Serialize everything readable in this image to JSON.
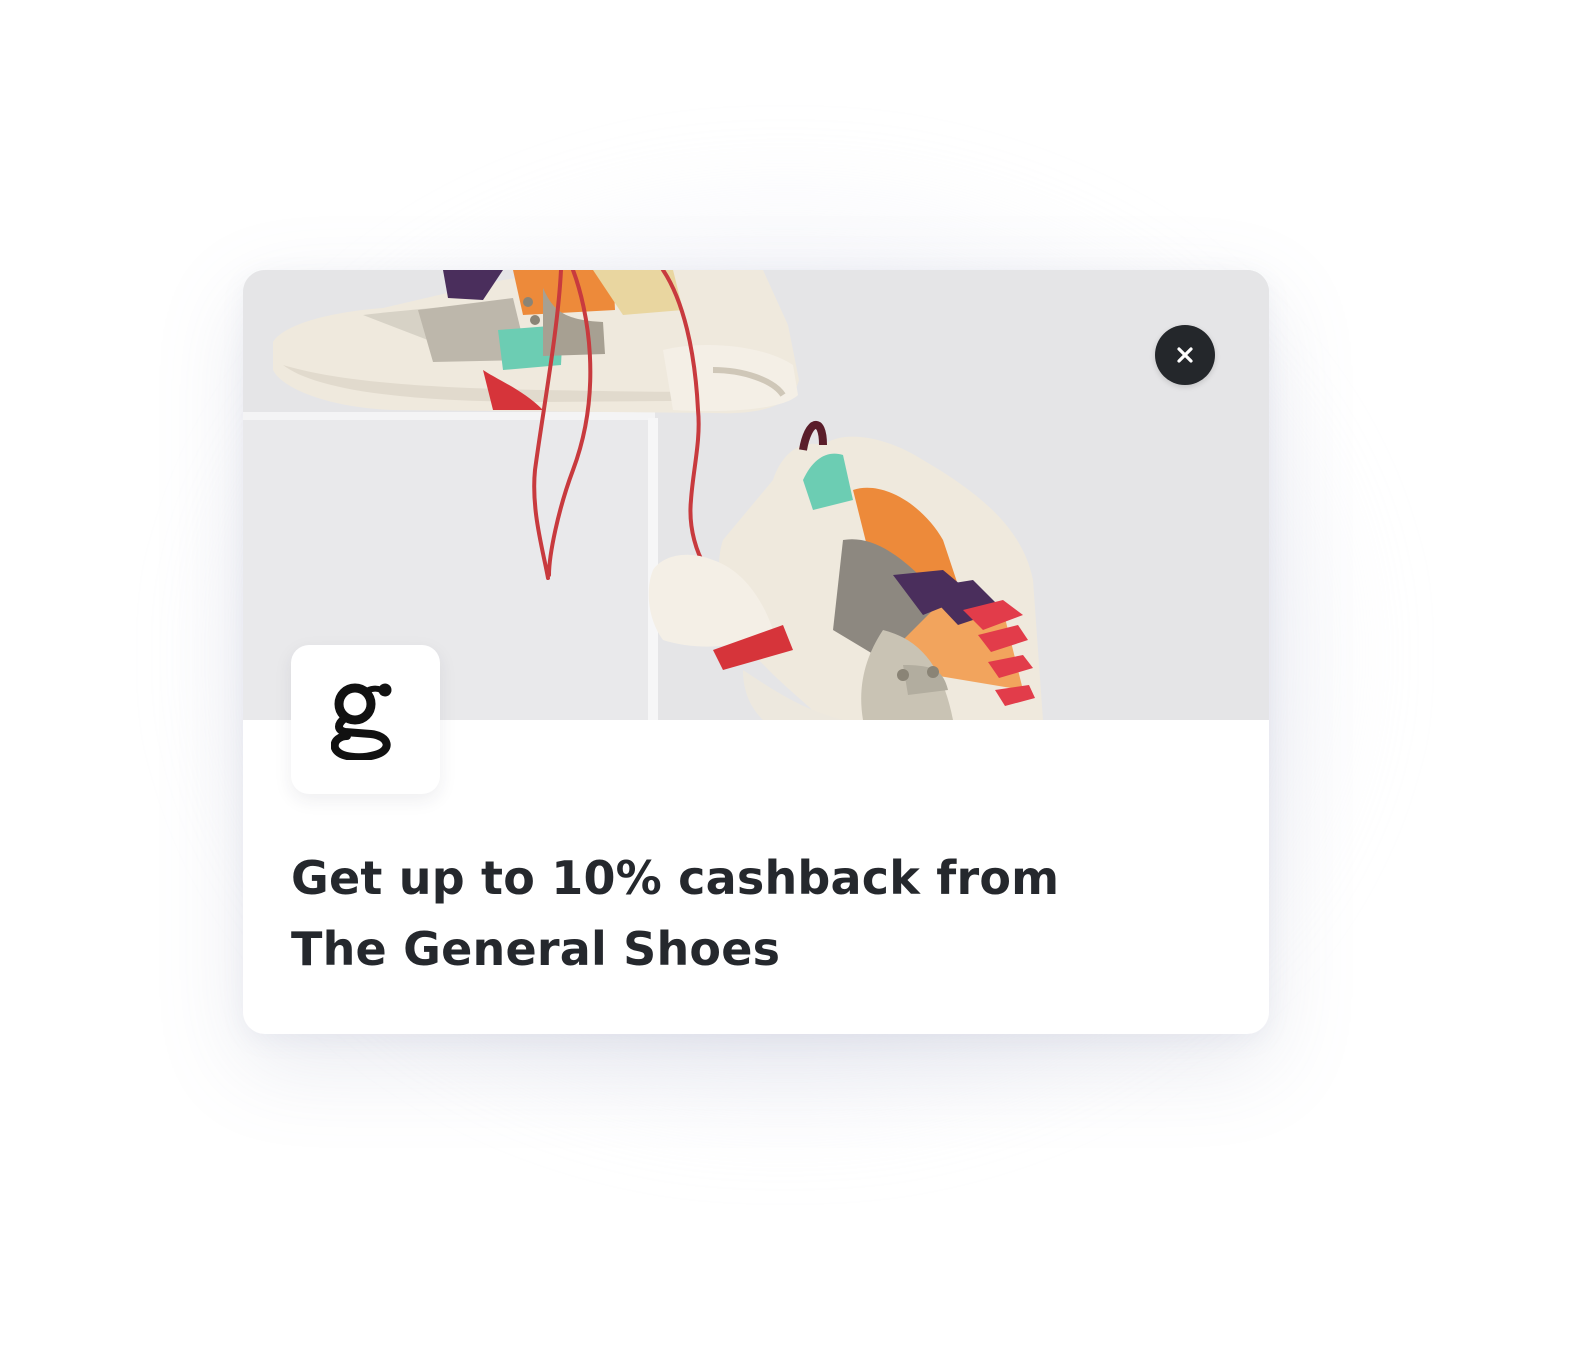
{
  "offer": {
    "headline": "Get up to 10% cashback from The General Shoes",
    "brand_logo_letter": "g",
    "hero_image": "sneakers-on-pedestal-photo",
    "close_icon": "close-icon"
  },
  "colors": {
    "headline_text": "#25282d",
    "close_button_bg": "#24272b",
    "card_bg": "#ffffff",
    "hero_bg": "#e6e6e8"
  }
}
